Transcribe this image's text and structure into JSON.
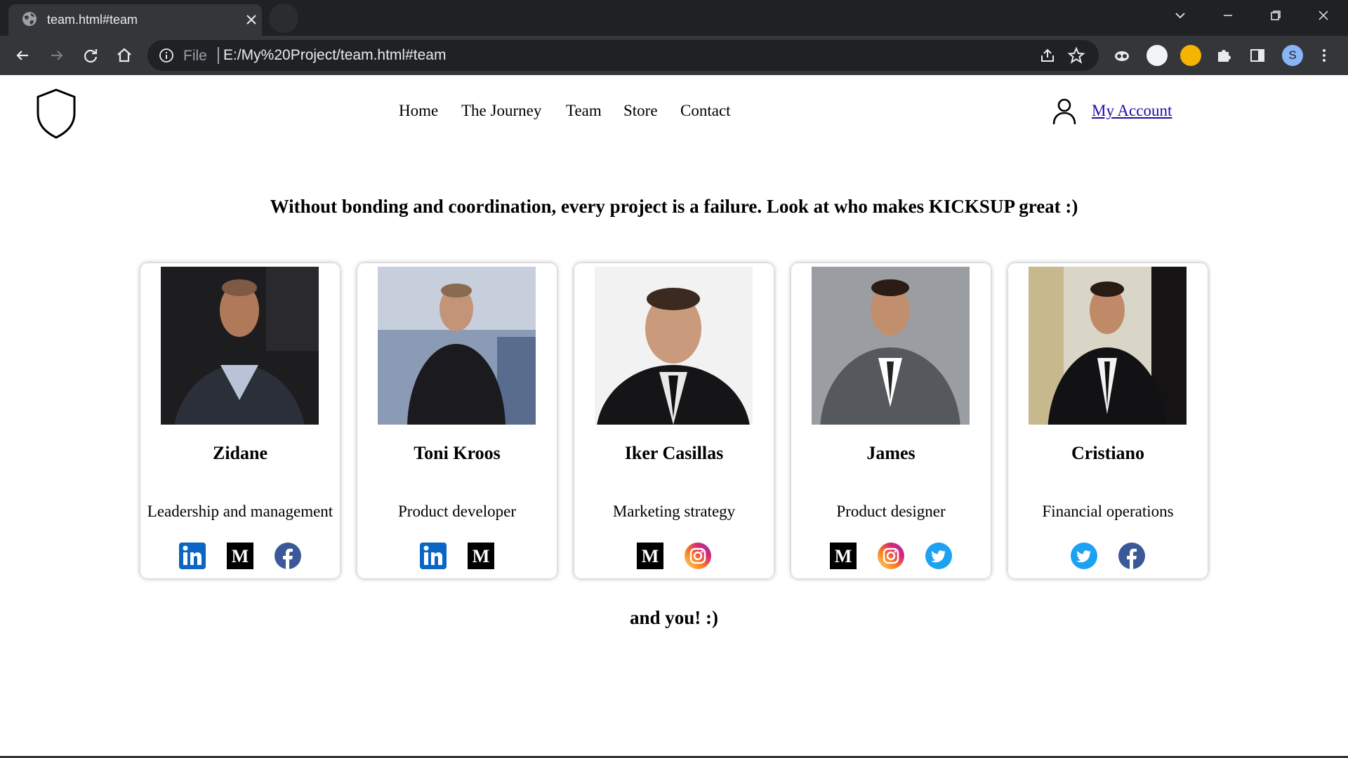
{
  "browser": {
    "tab_title": "team.html#team",
    "scheme_label": "File",
    "url": "E:/My%20Project/team.html#team",
    "profile_initial": "S"
  },
  "header": {
    "nav": [
      "Home",
      "The Journey",
      "Team",
      "Store",
      "Contact"
    ],
    "account_label": "My Account"
  },
  "tagline": "Without bonding and coordination, every project is a failure. Look at who makes KICKSUP great :)",
  "team": [
    {
      "name": "Zidane",
      "role": "Leadership and management",
      "socials": [
        "linkedin-icon",
        "medium-icon",
        "facebook-icon"
      ]
    },
    {
      "name": "Toni Kroos",
      "role": "Product developer",
      "socials": [
        "linkedin-icon",
        "medium-icon"
      ]
    },
    {
      "name": "Iker Casillas",
      "role": "Marketing strategy",
      "socials": [
        "medium-icon",
        "instagram-icon"
      ]
    },
    {
      "name": "James",
      "role": "Product designer",
      "socials": [
        "medium-icon",
        "instagram-icon",
        "twitter-icon"
      ]
    },
    {
      "name": "Cristiano",
      "role": "Financial operations",
      "socials": [
        "twitter-icon",
        "facebook-icon"
      ]
    }
  ],
  "outro": "and you! :)",
  "colors": {
    "linkedin": "#0a66c2",
    "facebook": "#3b5998",
    "twitter": "#1da1f2",
    "medium": "#000000",
    "link": "#1a0dab"
  }
}
